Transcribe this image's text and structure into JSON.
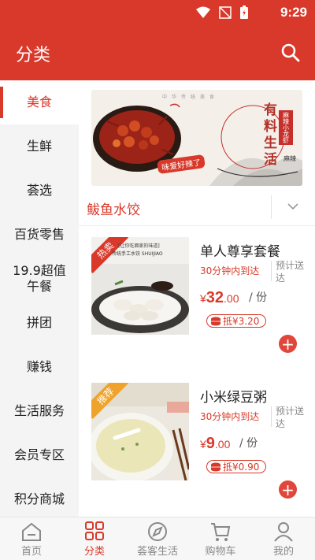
{
  "status_bar": {
    "time": "9:29"
  },
  "header": {
    "title": "分类",
    "search_icon": "search-icon"
  },
  "sidebar": {
    "items": [
      {
        "label": "美食",
        "active": true
      },
      {
        "label": "生鲜"
      },
      {
        "label": "荟选"
      },
      {
        "label": "百货零售"
      },
      {
        "label": "19.9超值午餐"
      },
      {
        "label": "拼团"
      },
      {
        "label": "赚钱"
      },
      {
        "label": "生活服务"
      },
      {
        "label": "会员专区"
      },
      {
        "label": "积分商城"
      }
    ]
  },
  "banner": {
    "slogan": "有料生活",
    "tag": "味爱好辣了",
    "topline": "中华传统美食",
    "seal": "麻辣小龙虾",
    "corner": "麻辣"
  },
  "section": {
    "title": "鲅鱼水饺"
  },
  "products": [
    {
      "badge": "热卖",
      "name": "单人尊享套餐",
      "delivery": "30分钟内到达",
      "predict": "预计送达",
      "price_symbol": "¥",
      "price_int": "32",
      "price_dec": ".00",
      "unit": "/ 份",
      "coupon": "抵¥3.20",
      "image_caption": "传统手工水饺 SHUIJIAO",
      "image_header": "[让你吃面家的味道]"
    },
    {
      "badge": "推荐",
      "name": "小米绿豆粥",
      "delivery": "30分钟内到达",
      "predict": "预计送达",
      "price_symbol": "¥",
      "price_int": "9",
      "price_dec": ".00",
      "unit": "/ 份",
      "coupon": "抵¥0.90"
    }
  ],
  "bottom_nav": {
    "items": [
      {
        "label": "首页",
        "icon": "home-icon"
      },
      {
        "label": "分类",
        "icon": "category-icon",
        "active": true
      },
      {
        "label": "荟客生活",
        "icon": "compass-icon"
      },
      {
        "label": "购物车",
        "icon": "cart-icon"
      },
      {
        "label": "我的",
        "icon": "profile-icon"
      }
    ]
  },
  "colors": {
    "accent": "#d8392a",
    "sidebar_bg": "#f4f4f4"
  }
}
